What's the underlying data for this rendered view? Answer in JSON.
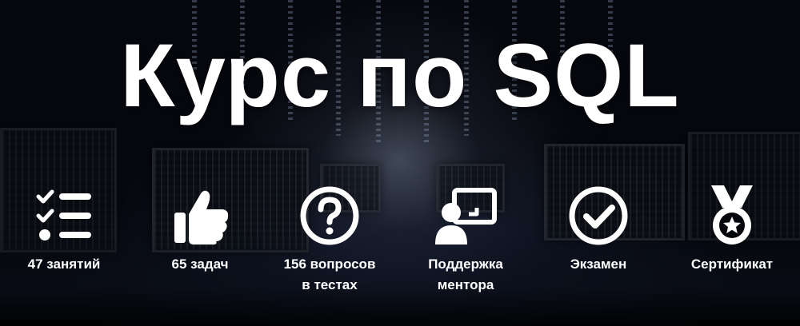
{
  "title": "Курс по SQL",
  "features": [
    {
      "icon": "checklist-icon",
      "label_line1": "47 занятий",
      "label_line2": ""
    },
    {
      "icon": "thumbs-up-icon",
      "label_line1": "65 задач",
      "label_line2": ""
    },
    {
      "icon": "question-circle-icon",
      "label_line1": "156 вопросов",
      "label_line2": "в тестах"
    },
    {
      "icon": "mentor-support-icon",
      "label_line1": "Поддержка",
      "label_line2": "ментора"
    },
    {
      "icon": "check-circle-icon",
      "label_line1": "Экзамен",
      "label_line2": ""
    },
    {
      "icon": "medal-icon",
      "label_line1": "Сертификат",
      "label_line2": ""
    }
  ],
  "colors": {
    "text": "#ffffff",
    "background": "#05070c"
  }
}
